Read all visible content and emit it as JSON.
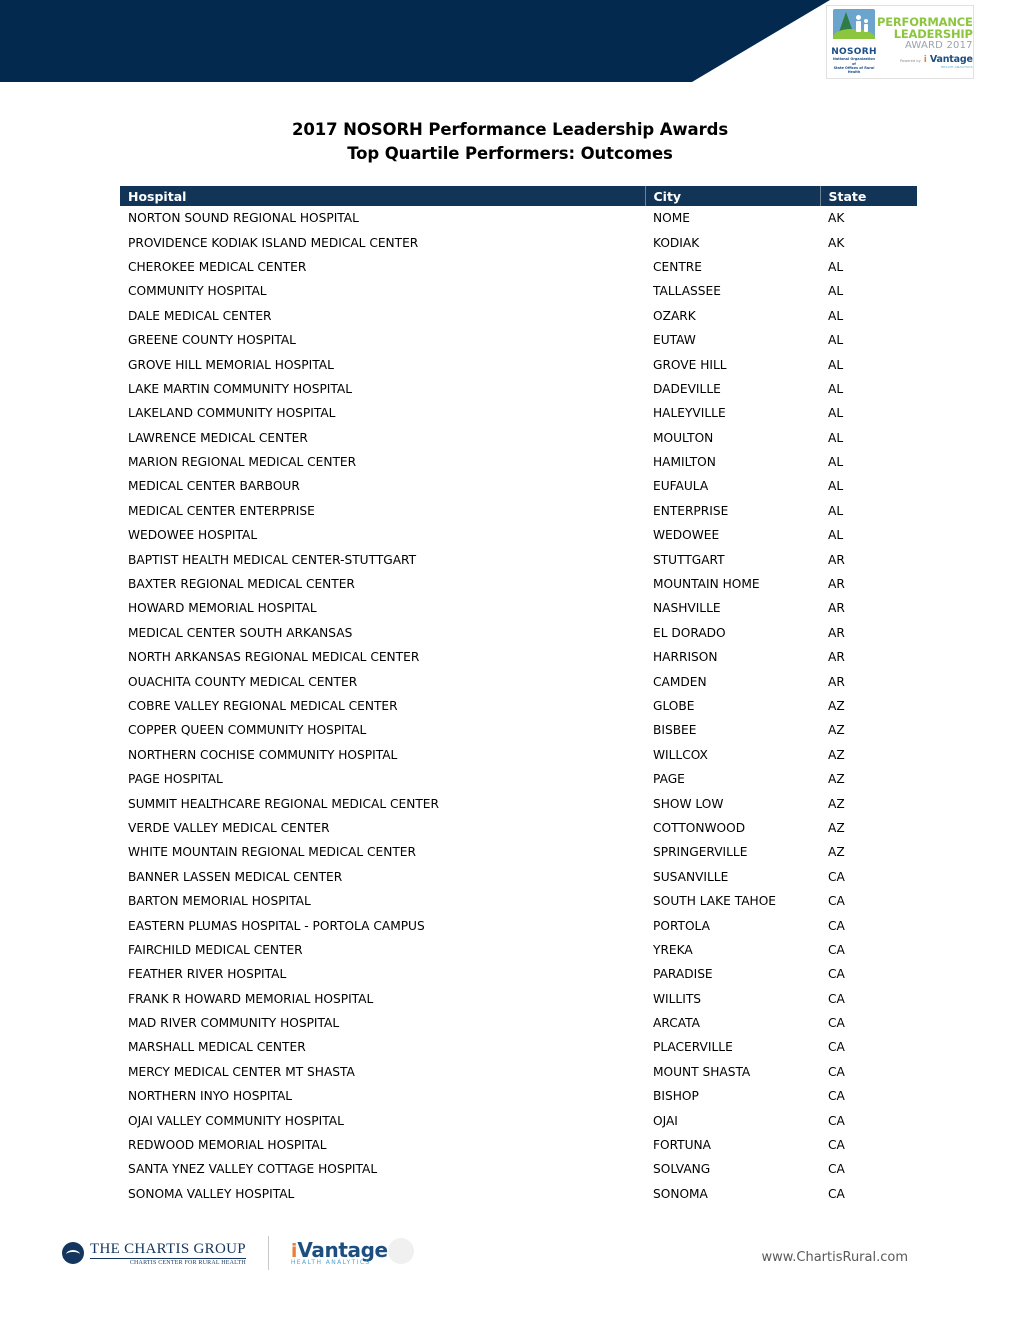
{
  "header": {
    "banner_color": "#04294f",
    "award_badge": {
      "org_name": "NOSORH",
      "org_sub_line1": "National Organization of",
      "org_sub_line2": "State Offices of Rural Health",
      "line1": "PERFORMANCE",
      "line2": "LEADERSHIP",
      "line3": "AWARD 2017",
      "powered_by": "Powered by",
      "vendor_i": "i",
      "vendor_name": "Vantage",
      "vendor_sub": "HEALTH ANALYTICS"
    }
  },
  "title": {
    "line1": "2017 NOSORH Performance Leadership Awards",
    "line2": "Top Quartile Performers: Outcomes"
  },
  "table": {
    "header_color": "#123457",
    "columns": [
      "Hospital",
      "City",
      "State"
    ],
    "rows": [
      [
        "NORTON SOUND REGIONAL HOSPITAL",
        "NOME",
        "AK"
      ],
      [
        "PROVIDENCE KODIAK ISLAND MEDICAL CENTER",
        "KODIAK",
        "AK"
      ],
      [
        "CHEROKEE MEDICAL CENTER",
        "CENTRE",
        "AL"
      ],
      [
        "COMMUNITY HOSPITAL",
        "TALLASSEE",
        "AL"
      ],
      [
        "DALE MEDICAL CENTER",
        "OZARK",
        "AL"
      ],
      [
        "GREENE COUNTY HOSPITAL",
        "EUTAW",
        "AL"
      ],
      [
        "GROVE HILL MEMORIAL HOSPITAL",
        "GROVE HILL",
        "AL"
      ],
      [
        "LAKE MARTIN COMMUNITY HOSPITAL",
        "DADEVILLE",
        "AL"
      ],
      [
        "LAKELAND COMMUNITY HOSPITAL",
        "HALEYVILLE",
        "AL"
      ],
      [
        "LAWRENCE MEDICAL CENTER",
        "MOULTON",
        "AL"
      ],
      [
        "MARION REGIONAL MEDICAL CENTER",
        "HAMILTON",
        "AL"
      ],
      [
        "MEDICAL CENTER BARBOUR",
        "EUFAULA",
        "AL"
      ],
      [
        "MEDICAL CENTER ENTERPRISE",
        "ENTERPRISE",
        "AL"
      ],
      [
        "WEDOWEE HOSPITAL",
        "WEDOWEE",
        "AL"
      ],
      [
        "BAPTIST HEALTH MEDICAL CENTER-STUTTGART",
        "STUTTGART",
        "AR"
      ],
      [
        "BAXTER REGIONAL MEDICAL CENTER",
        "MOUNTAIN HOME",
        "AR"
      ],
      [
        "HOWARD MEMORIAL HOSPITAL",
        "NASHVILLE",
        "AR"
      ],
      [
        "MEDICAL CENTER SOUTH ARKANSAS",
        "EL DORADO",
        "AR"
      ],
      [
        "NORTH ARKANSAS REGIONAL MEDICAL CENTER",
        "HARRISON",
        "AR"
      ],
      [
        "OUACHITA COUNTY MEDICAL CENTER",
        "CAMDEN",
        "AR"
      ],
      [
        "COBRE VALLEY REGIONAL MEDICAL CENTER",
        "GLOBE",
        "AZ"
      ],
      [
        "COPPER QUEEN COMMUNITY HOSPITAL",
        "BISBEE",
        "AZ"
      ],
      [
        "NORTHERN COCHISE COMMUNITY HOSPITAL",
        "WILLCOX",
        "AZ"
      ],
      [
        "PAGE HOSPITAL",
        "PAGE",
        "AZ"
      ],
      [
        "SUMMIT HEALTHCARE REGIONAL MEDICAL CENTER",
        "SHOW LOW",
        "AZ"
      ],
      [
        "VERDE VALLEY MEDICAL CENTER",
        "COTTONWOOD",
        "AZ"
      ],
      [
        "WHITE MOUNTAIN REGIONAL MEDICAL CENTER",
        "SPRINGERVILLE",
        "AZ"
      ],
      [
        "BANNER LASSEN MEDICAL CENTER",
        "SUSANVILLE",
        "CA"
      ],
      [
        "BARTON MEMORIAL HOSPITAL",
        "SOUTH LAKE TAHOE",
        "CA"
      ],
      [
        "EASTERN PLUMAS HOSPITAL - PORTOLA CAMPUS",
        "PORTOLA",
        "CA"
      ],
      [
        "FAIRCHILD MEDICAL CENTER",
        "YREKA",
        "CA"
      ],
      [
        "FEATHER RIVER HOSPITAL",
        "PARADISE",
        "CA"
      ],
      [
        "FRANK R HOWARD MEMORIAL HOSPITAL",
        "WILLITS",
        "CA"
      ],
      [
        "MAD RIVER COMMUNITY HOSPITAL",
        "ARCATA",
        "CA"
      ],
      [
        "MARSHALL MEDICAL CENTER",
        "PLACERVILLE",
        "CA"
      ],
      [
        "MERCY MEDICAL CENTER MT SHASTA",
        "MOUNT SHASTA",
        "CA"
      ],
      [
        "NORTHERN INYO HOSPITAL",
        "BISHOP",
        "CA"
      ],
      [
        "OJAI VALLEY COMMUNITY HOSPITAL",
        "OJAI",
        "CA"
      ],
      [
        "REDWOOD MEMORIAL HOSPITAL",
        "FORTUNA",
        "CA"
      ],
      [
        "SANTA YNEZ VALLEY COTTAGE HOSPITAL",
        "SOLVANG",
        "CA"
      ],
      [
        "SONOMA VALLEY HOSPITAL",
        "SONOMA",
        "CA"
      ]
    ]
  },
  "footer": {
    "chartis_name": "THE CHARTIS GROUP",
    "chartis_sub": "CHARTIS CENTER FOR RURAL HEALTH",
    "ivantage_i": "i",
    "ivantage_name": "Vantage",
    "ivantage_sub": "HEALTH ANALYTICS",
    "url": "www.ChartisRural.com"
  }
}
